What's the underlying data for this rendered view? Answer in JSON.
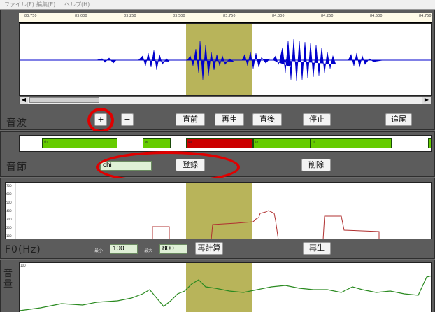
{
  "menu": [
    {
      "id": "file",
      "label": "ファイル(F)"
    },
    {
      "id": "edit",
      "label": "編集(E)"
    },
    {
      "id": "help",
      "label": "ヘルプ(H)"
    }
  ],
  "waveform": {
    "label": "音波",
    "ruler_ticks": [
      "83.750",
      "83.000",
      "83.250",
      "83.500",
      "83.750",
      "84.000",
      "84.250",
      "84.500",
      "84.750"
    ],
    "buttons": {
      "zoom_in": "+",
      "zoom_out": "−",
      "prev": "直前",
      "play": "再生",
      "next": "直後",
      "stop": "停止",
      "follow": "追尾"
    }
  },
  "syllable": {
    "label": "音節",
    "input_prefix": "名",
    "input_value": "chi",
    "register_label": "登録",
    "delete_label": "削除",
    "segments": [
      {
        "label": "shi",
        "color": "#66cc00"
      },
      {
        "label": "ke",
        "color": "#66cc00"
      },
      {
        "label": "ga",
        "color": "#cc0000"
      },
      {
        "label": "te",
        "color": "#66cc00"
      },
      {
        "label": "ni",
        "color": "#66cc00"
      },
      {
        "label": "",
        "color": "#66cc00"
      }
    ]
  },
  "f0": {
    "label": "F0(Hz)",
    "min_label": "最小",
    "min_value": "100",
    "max_label": "最大",
    "max_value": "800",
    "recalc_label": "再計算",
    "play_label": "再生",
    "y_ticks": [
      "700",
      "600",
      "500",
      "400",
      "300",
      "200",
      "100"
    ]
  },
  "volume": {
    "label": "音量",
    "top_tick": "100"
  },
  "colors": {
    "selection": "#b8b45a",
    "wave": "#0000cc",
    "f0_curve": "#b03030",
    "volume_curve": "#2a8a20",
    "annotation": "#e00000"
  }
}
